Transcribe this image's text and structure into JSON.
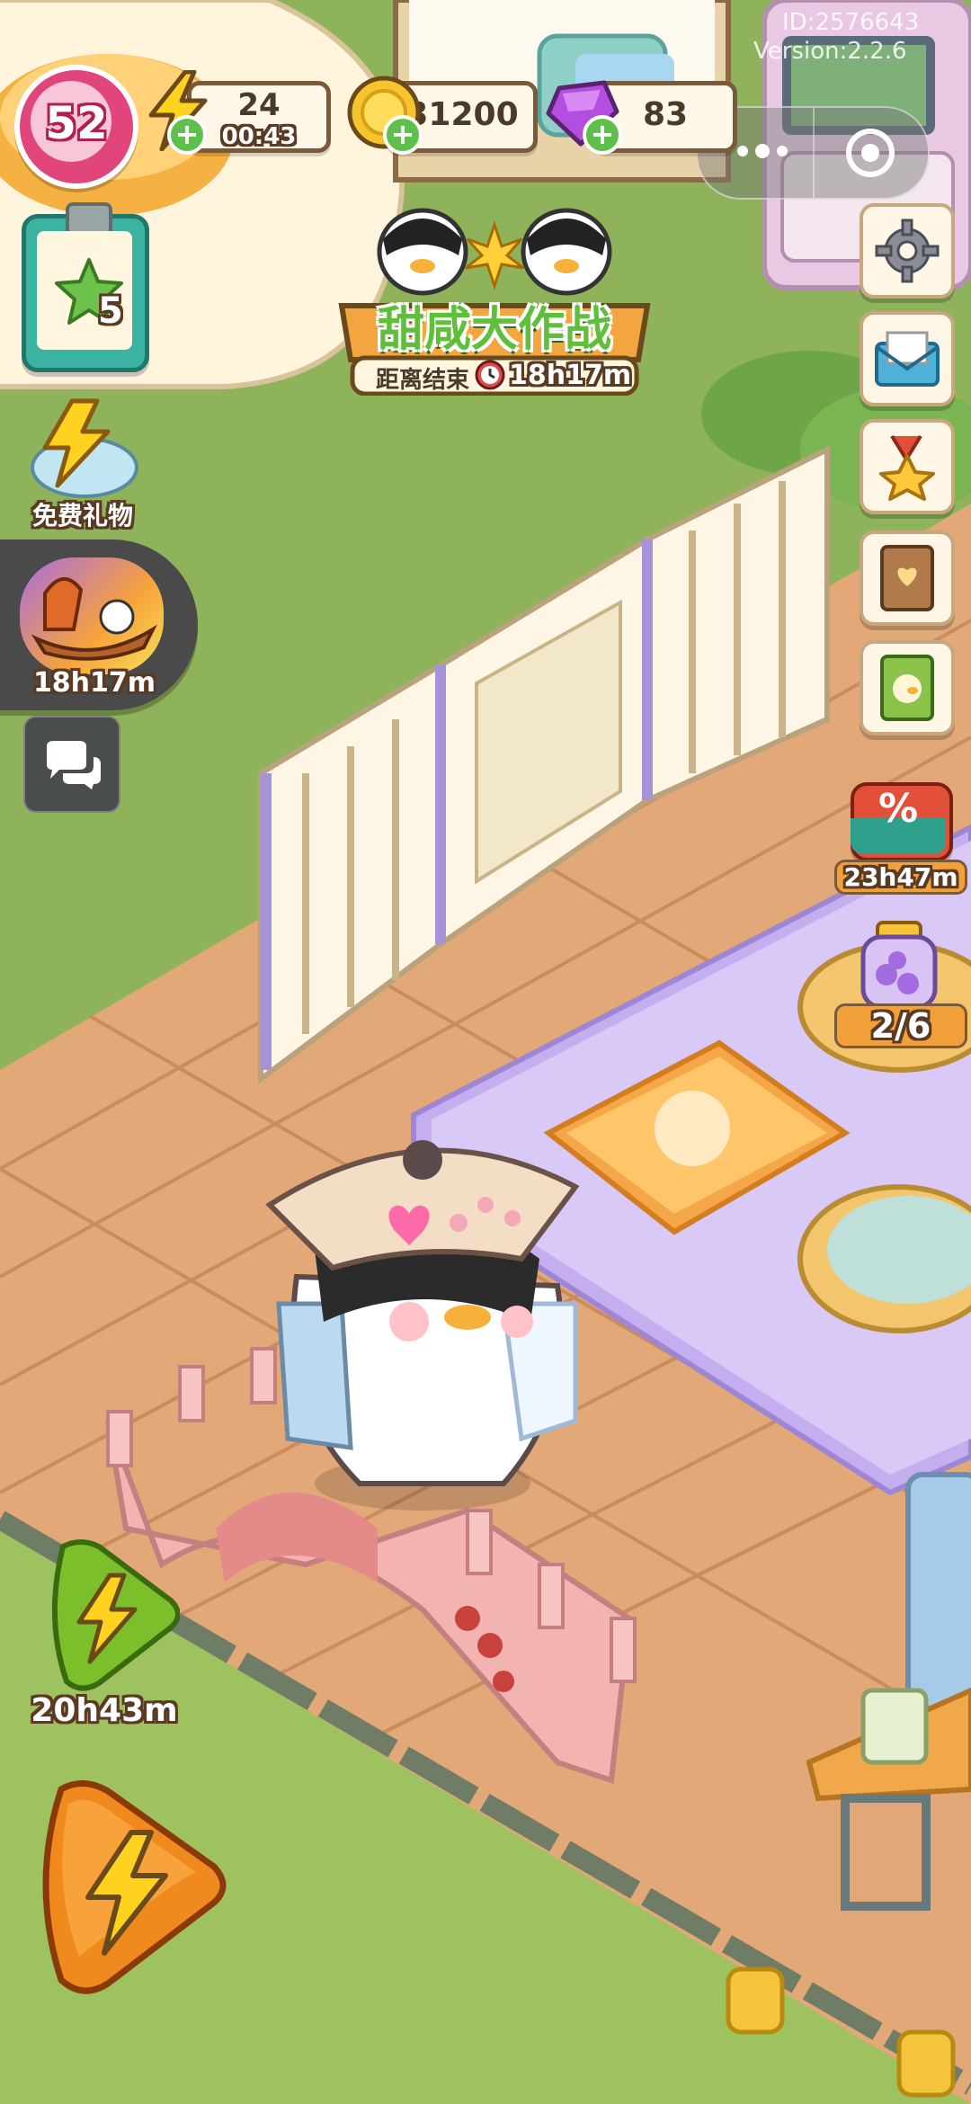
{
  "debug": {
    "id": "ID:2576643",
    "version": "Version:2.2.6"
  },
  "hud": {
    "level": "52",
    "energy": {
      "count": "24",
      "timer": "00:43"
    },
    "coins": "31200",
    "gems": "83"
  },
  "quest_board": {
    "count": "5"
  },
  "event_banner": {
    "title": "甜咸大作战",
    "countdown_label": "距离结束",
    "countdown": "18h17m"
  },
  "free_gift": {
    "label": "免费礼物"
  },
  "boat_event": {
    "timer": "18h17m"
  },
  "shop_sale": {
    "timer": "23h47m"
  },
  "jar_progress": {
    "value": "2/6"
  },
  "boost_green": {
    "timer": "20h43m"
  },
  "icons": [
    "lightning-icon",
    "coin-icon",
    "gem-icon",
    "gear-icon",
    "mail-icon",
    "medal-icon",
    "book-icon",
    "album-icon",
    "chat-icon",
    "percent-icon",
    "more-icon",
    "target-icon"
  ],
  "colors": {
    "grass": "#8fb35a",
    "floor": "#e2a877",
    "rug": "#c9b6ef",
    "hud_border": "#7a5a3a",
    "level_pink": "#e0457b"
  }
}
